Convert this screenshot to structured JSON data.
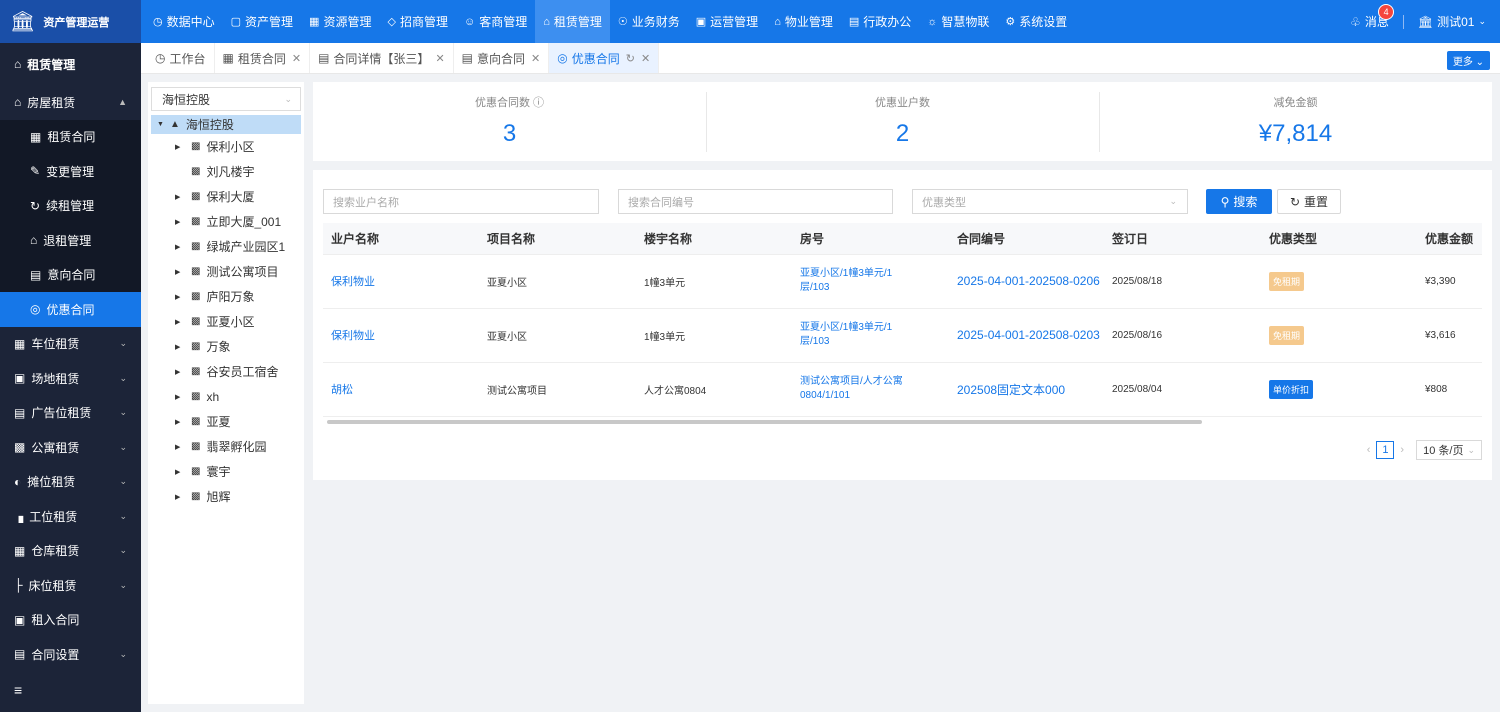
{
  "app": {
    "title": "资产管理运营"
  },
  "nav": {
    "items": [
      {
        "label": "数据中心"
      },
      {
        "label": "资产管理"
      },
      {
        "label": "资源管理"
      },
      {
        "label": "招商管理"
      },
      {
        "label": "客商管理"
      },
      {
        "label": "租赁管理"
      },
      {
        "label": "业务财务"
      },
      {
        "label": "运营管理"
      },
      {
        "label": "物业管理"
      },
      {
        "label": "行政办公"
      },
      {
        "label": "智慧物联"
      },
      {
        "label": "系统设置"
      }
    ],
    "active": "租赁管理",
    "messages_label": "消息",
    "messages_count": "4",
    "user": "测试01"
  },
  "sidebar": {
    "header": "租赁管理",
    "group": "房屋租赁",
    "sub_items": [
      {
        "label": "租赁合同"
      },
      {
        "label": "变更管理"
      },
      {
        "label": "续租管理"
      },
      {
        "label": "退租管理"
      },
      {
        "label": "意向合同"
      },
      {
        "label": "优惠合同"
      }
    ],
    "other_items": [
      {
        "label": "车位租赁"
      },
      {
        "label": "场地租赁"
      },
      {
        "label": "广告位租赁"
      },
      {
        "label": "公寓租赁"
      },
      {
        "label": "摊位租赁"
      },
      {
        "label": "工位租赁"
      },
      {
        "label": "仓库租赁"
      },
      {
        "label": "床位租赁"
      },
      {
        "label": "租入合同"
      },
      {
        "label": "合同设置"
      }
    ]
  },
  "tabs": [
    {
      "label": "工作台"
    },
    {
      "label": "租赁合同"
    },
    {
      "label": "合同详情【张三】"
    },
    {
      "label": "意向合同"
    },
    {
      "label": "优惠合同"
    }
  ],
  "more_label": "更多",
  "tree": {
    "select_value": "海恒控股",
    "root": "海恒控股",
    "nodes": [
      {
        "label": "保利小区",
        "expandable": true
      },
      {
        "label": "刘凡楼宇",
        "expandable": false
      },
      {
        "label": "保利大厦",
        "expandable": true
      },
      {
        "label": "立即大厦_001",
        "expandable": true
      },
      {
        "label": "绿城产业园区1",
        "expandable": true
      },
      {
        "label": "测试公寓项目",
        "expandable": true
      },
      {
        "label": "庐阳万象",
        "expandable": true
      },
      {
        "label": "亚夏小区",
        "expandable": true
      },
      {
        "label": "万象",
        "expandable": true
      },
      {
        "label": "谷安员工宿舍",
        "expandable": true
      },
      {
        "label": "xh",
        "expandable": true
      },
      {
        "label": "亚夏",
        "expandable": true
      },
      {
        "label": "翡翠孵化园",
        "expandable": true
      },
      {
        "label": "寰宇",
        "expandable": true
      },
      {
        "label": "旭辉",
        "expandable": true
      }
    ]
  },
  "stats": [
    {
      "label": "优惠合同数",
      "value": "3"
    },
    {
      "label": "优惠业户数",
      "value": "2"
    },
    {
      "label": "减免金额",
      "value": "¥7,814"
    }
  ],
  "filters": {
    "owner_placeholder": "搜索业户名称",
    "contract_placeholder": "搜索合同编号",
    "type_placeholder": "优惠类型",
    "search_label": "搜索",
    "reset_label": "重置"
  },
  "table": {
    "columns": [
      "业户名称",
      "项目名称",
      "楼宇名称",
      "房号",
      "合同编号",
      "签订日",
      "优惠类型",
      "优惠金额"
    ],
    "rows": [
      {
        "owner": "保利物业",
        "project": "亚夏小区",
        "building": "1幢3单元",
        "room": "亚夏小区/1幢3单元/1层/103",
        "contract": "2025-04-001-202508-0206",
        "date": "2025/08/18",
        "type": "免租期",
        "type_style": "free",
        "amount": "¥3,390"
      },
      {
        "owner": "保利物业",
        "project": "亚夏小区",
        "building": "1幢3单元",
        "room": "亚夏小区/1幢3单元/1层/103",
        "contract": "2025-04-001-202508-0203",
        "date": "2025/08/16",
        "type": "免租期",
        "type_style": "free",
        "amount": "¥3,616"
      },
      {
        "owner": "胡松",
        "project": "测试公寓项目",
        "building": "人才公寓0804",
        "room": "测试公寓项目/人才公寓0804/1/101",
        "contract": "202508固定文本000",
        "date": "2025/08/04",
        "type": "单价折扣",
        "type_style": "disc",
        "amount": "¥808"
      }
    ]
  },
  "pagination": {
    "current": "1",
    "page_size": "10 条/页"
  }
}
